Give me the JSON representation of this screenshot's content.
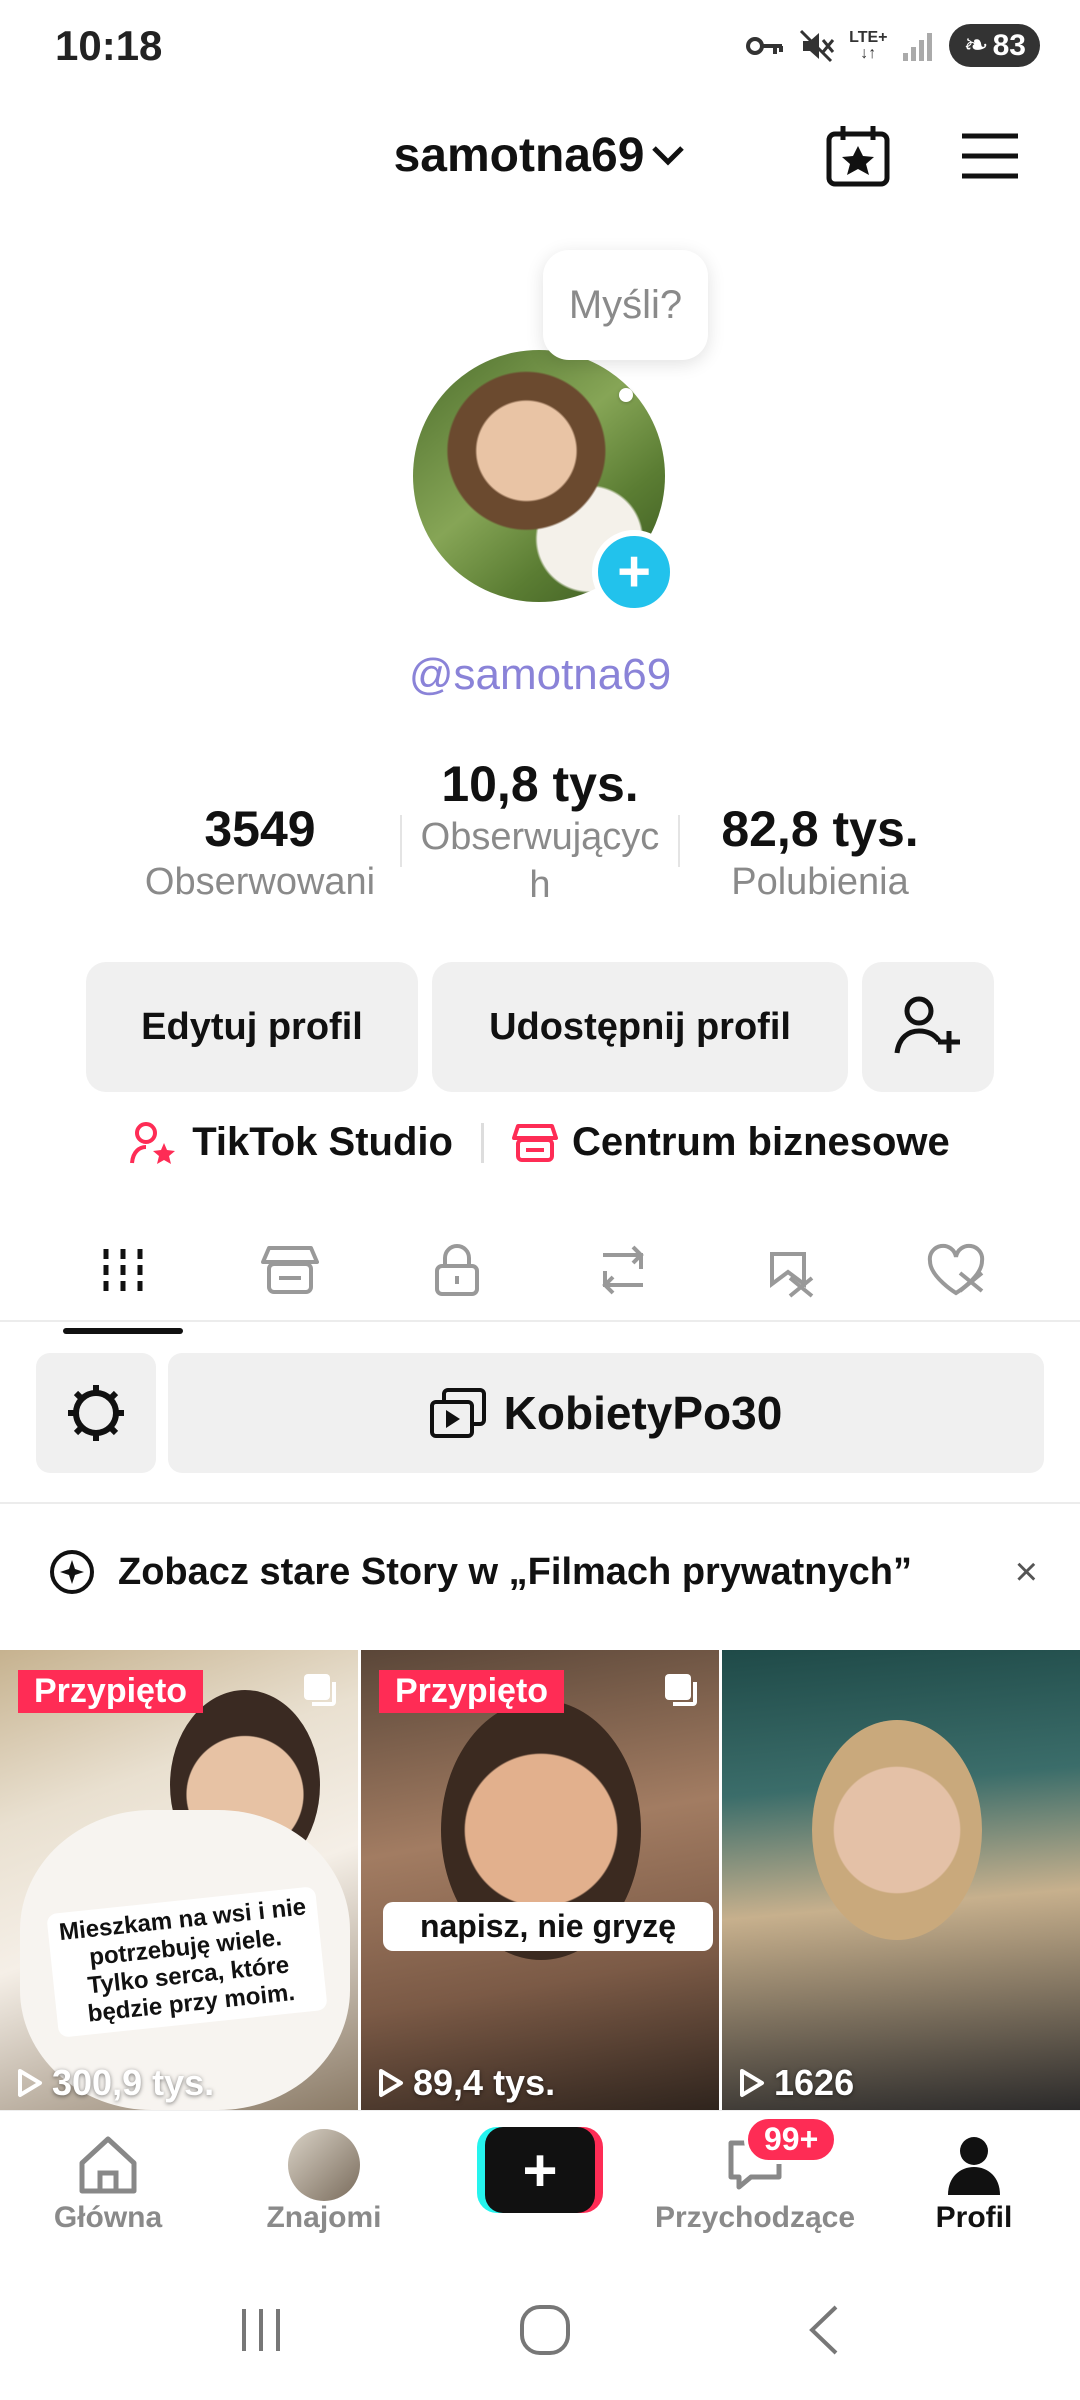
{
  "status_bar": {
    "time": "10:18",
    "network": "LTE+",
    "battery": "83"
  },
  "header": {
    "username": "samotna69"
  },
  "profile": {
    "bubble_text": "Myśli?",
    "handle": "@samotna69",
    "stats": [
      {
        "value": "3549",
        "label": "Obserwowani"
      },
      {
        "value": "10,8 tys.",
        "label_line1": "Obserwującyc",
        "label_line2": "h"
      },
      {
        "value": "82,8 tys.",
        "label": "Polubienia"
      }
    ]
  },
  "buttons": {
    "edit": "Edytuj profil",
    "share": "Udostępnij profil"
  },
  "links": {
    "studio": "TikTok Studio",
    "business": "Centrum biznesowe"
  },
  "tabs": [
    "videos-grid-icon",
    "shop-icon",
    "lock-icon",
    "repost-icon",
    "favorites-icon",
    "liked-icon"
  ],
  "collection": {
    "name": "KobietyPo30"
  },
  "notice": {
    "text": "Zobacz stare Story w „Filmach prywatnych”",
    "close": "×"
  },
  "videos": [
    {
      "pinned": "Przypięto",
      "caption": "Mieszkam na wsi i nie potrzebuję wiele. Tylko serca, które będzie przy moim.",
      "views": "300,9 tys."
    },
    {
      "pinned": "Przypięto",
      "caption": "napisz, nie gryzę",
      "views": "89,4 tys."
    },
    {
      "views": "1626"
    }
  ],
  "bottom_nav": {
    "home": "Główna",
    "friends": "Znajomi",
    "inbox": "Przychodzące",
    "inbox_badge": "99+",
    "profile": "Profil"
  },
  "colors": {
    "accent": "#fe2c55",
    "handle": "#8a83d8",
    "add_badge": "#22c2ec",
    "cyan": "#25f4ee"
  }
}
